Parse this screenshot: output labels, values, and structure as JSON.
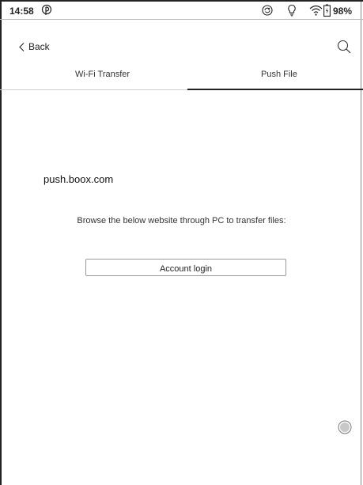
{
  "status_bar": {
    "time": "14:58",
    "battery_percent": "98%",
    "icons": [
      "pinterest-icon",
      "sync-icon",
      "lightbulb-icon",
      "wifi-icon",
      "battery-icon"
    ]
  },
  "header": {
    "back_label": "Back",
    "icons": [
      "chevron-left-icon",
      "search-icon"
    ]
  },
  "tabs": [
    {
      "label": "Wi-Fi Transfer",
      "active": false
    },
    {
      "label": "Push File",
      "active": true
    }
  ],
  "content": {
    "url": "push.boox.com",
    "instruction": "Browse the below website through PC to transfer files:",
    "login_button": "Account login"
  },
  "floating_button": {
    "icon": "circle-button-icon"
  },
  "colors": {
    "text": "#222222",
    "background": "#ffffff",
    "divider": "#cfcfcf"
  }
}
